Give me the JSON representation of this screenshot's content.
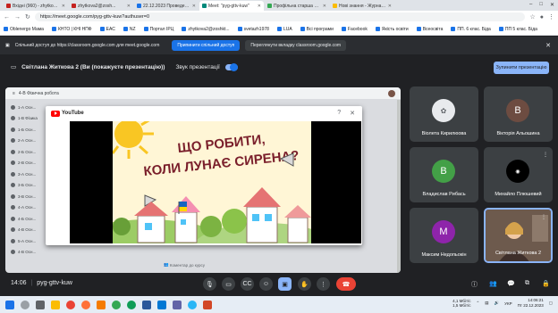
{
  "browser": {
    "tabs": [
      {
        "label": "Вхідні (960) - zhytkova2@sosh...",
        "color": "#c5221f",
        "active": false
      },
      {
        "label": "zhytkova2@zosh...",
        "color": "#c5221f",
        "active": false
      },
      {
        "label": "22.12.2023 Проведення о...",
        "color": "#1a73e8",
        "active": false
      },
      {
        "label": "Meet: \"pyg-gttv-kuw\"",
        "color": "#00897b",
        "active": true
      },
      {
        "label": "Профільна старша школа: вов...",
        "color": "#34a853",
        "active": false
      },
      {
        "label": "Нові знання - Журнали - Елек...",
        "color": "#fbbc04",
        "active": false
      }
    ],
    "url": "https://meet.google.com/pyg-gttv-kuw?authuser=0",
    "bookmarks": [
      "Oblenergo Мама",
      "КНТО | КНІ НПФ",
      "EAC",
      "NZ",
      "Портал IPЦ",
      "zhytkova2@zoshkt...",
      "svetazh1978",
      "LUA",
      "Всі програми",
      "Facebook",
      "Якість освіти",
      "Всеосвіта",
      "ПП. 6 клас. Біда",
      "ПП 5 клас. Біда"
    ]
  },
  "share_banner": {
    "text": "Спільний доступ до https://classroom.google.com для meet.google.com",
    "stop_label": "Припинити спільний доступ",
    "switch_label": "Переглянути вкладку classroom.google.com"
  },
  "presenting": {
    "title": "Світлана Житкова 2 (Ви (покажуєте презентацію))",
    "sound_label": "Звук презентації",
    "stop_button": "Зупинити презентацію"
  },
  "classroom": {
    "header": "4-В Фізична робота",
    "subheader": "4-В Фізична робота",
    "rows": [
      "1-А Осн...",
      "1-В Фізика",
      "1-Б Осн...",
      "2-А Осн...",
      "2-Б Осн...",
      "2-В Осн...",
      "3-А Осн...",
      "3-Б Осн...",
      "3-В Осн...",
      "4-А Осн...",
      "4-Б Осн...",
      "4-В Осн...",
      "5-А Осн...",
      "4-В Осн...",
      "4-В Інформатика"
    ],
    "comment_label": "Коментар до курсу"
  },
  "youtube": {
    "logo_text": "YouTube",
    "video_title": "ЩО РОБИТИ, КОЛИ ЛУНАЄ СИРЕНА?",
    "help_icon": "help-icon",
    "close_icon": "close-icon"
  },
  "participants": [
    {
      "name": "Віолета Кирилюова",
      "initial": "",
      "color": "#e8eaed"
    },
    {
      "name": "Вікторія Альошина",
      "initial": "В",
      "color": "#6d4c41"
    },
    {
      "name": "Владислав Рибась",
      "initial": "В",
      "color": "#43a047"
    },
    {
      "name": "Михайло Плюшевий",
      "initial": "",
      "color": "#000000"
    },
    {
      "name": "Максим Недопьокін",
      "initial": "M",
      "color": "#8e24aa"
    },
    {
      "name": "Світлана Житкова 2",
      "initial": "",
      "color": "#5b4a3f"
    }
  ],
  "meet": {
    "time": "14:06",
    "separator": "|",
    "meeting_code": "pyg-gttv-kuw",
    "end_call_icon": "end-call-icon"
  },
  "taskbar": {
    "net_up": "4,1 Мбіт/с",
    "net_down": "1,5 Мбіт/с",
    "lang": "УКР",
    "clock_time": "14:06:21",
    "clock_date": "Пт 22.12.2023"
  }
}
